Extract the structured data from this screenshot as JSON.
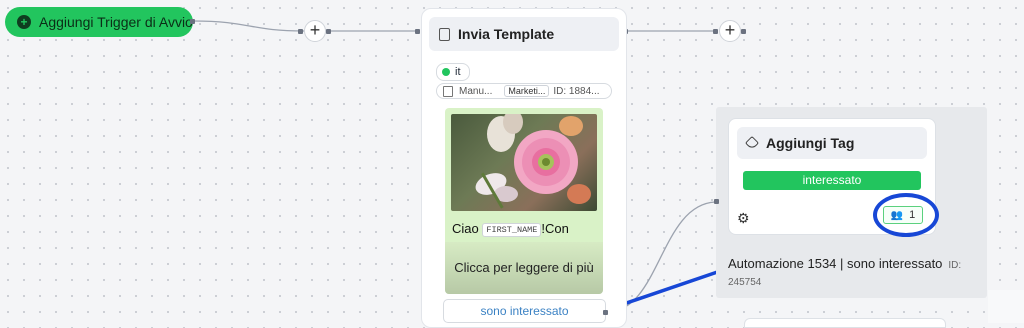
{
  "trigger": {
    "label": "Aggiungi Trigger di Avvio"
  },
  "template_node": {
    "title": "Invia Template",
    "language": "it",
    "template_name": "Manu...",
    "category": "Marketi...",
    "template_id": "ID: 1884...",
    "preview": {
      "text_before": "Ciao",
      "variable": "FIRST_NAME",
      "text_after": "!Con",
      "button_label": "Clicca per leggere di più"
    },
    "reply_button": "sono interessato"
  },
  "tag_node": {
    "title": "Aggiungi Tag",
    "tag": "interessato",
    "count": "1"
  },
  "automation": {
    "title": "Automazione 1534 | sono interessato",
    "id_label": "ID:",
    "id_value": "245754"
  },
  "colors": {
    "accent_green": "#22c55e",
    "annotation_blue": "#1747d6",
    "reply_text": "#3b82c4"
  },
  "icons": [
    "plus-circle-icon",
    "add-node-icon",
    "template-icon",
    "tag-icon",
    "gear-icon",
    "users-icon",
    "annotation-arrow"
  ]
}
